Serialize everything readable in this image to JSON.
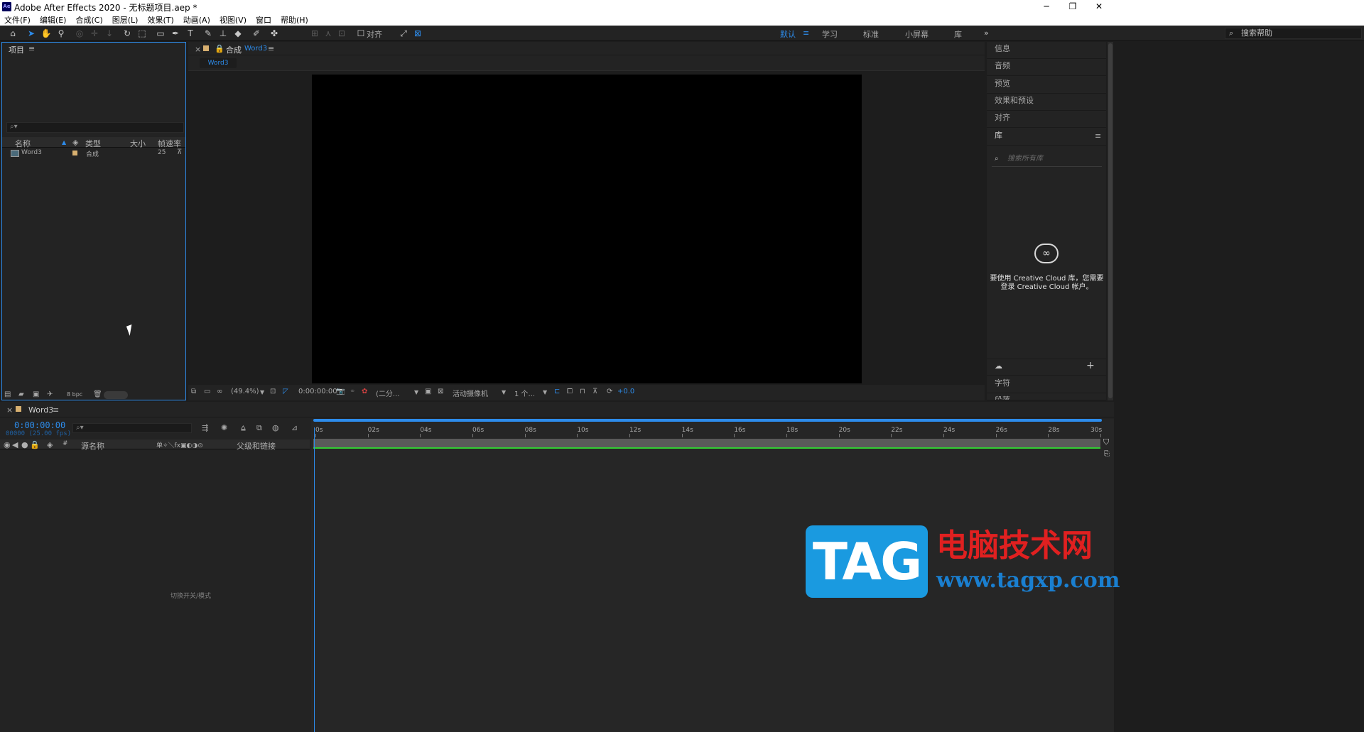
{
  "window": {
    "app_icon": "Ae",
    "title": "Adobe After Effects 2020 - 无标题项目.aep *",
    "minimize": "─",
    "maximize": "❐",
    "close": "✕"
  },
  "menu": [
    "文件(F)",
    "编辑(E)",
    "合成(C)",
    "图层(L)",
    "效果(T)",
    "动画(A)",
    "视图(V)",
    "窗口",
    "帮助(H)"
  ],
  "toolbar": {
    "align_label": "对齐",
    "workspaces": [
      "默认",
      "学习",
      "标准",
      "小屏幕",
      "库"
    ],
    "active_workspace": "默认",
    "more": "»",
    "help_search_placeholder": "搜索帮助"
  },
  "project": {
    "title": "项目",
    "search_placeholder": "⌕▾",
    "columns": [
      "名称",
      "类型",
      "大小",
      "帧速率"
    ],
    "items": [
      {
        "name": "Word3",
        "type": "合成",
        "size": "",
        "fps": "25"
      }
    ],
    "bpc": "8 bpc"
  },
  "composition": {
    "title_prefix": "合成",
    "comp_name": "Word3",
    "subtab": "Word3",
    "zoom": "(49.4%)",
    "timecode": "0:00:00:00",
    "resolution": "(二分...",
    "camera": "活动摄像机",
    "views": "1 个...",
    "exposure": "+0.0"
  },
  "right_panels": {
    "items": [
      "信息",
      "音频",
      "预览",
      "效果和预设",
      "对齐"
    ],
    "library_title": "库",
    "library_search_placeholder": "搜索所有库",
    "library_message": "要使用 Creative Cloud 库，您需要登录 Creative Cloud 帐户。",
    "character": "字符",
    "paragraph": "段落"
  },
  "timeline": {
    "comp_name": "Word3",
    "time": "0:00:00:00",
    "fps_info": "00000 (25.00 fps)",
    "search_placeholder": "⌕▾",
    "col_source": "源名称",
    "col_parent": "父级和链接",
    "col_hash": "#",
    "ticks": [
      "0s",
      "02s",
      "04s",
      "06s",
      "08s",
      "10s",
      "12s",
      "14s",
      "16s",
      "18s",
      "20s",
      "22s",
      "24s",
      "26s",
      "28s",
      "30s"
    ],
    "footer": "切换开关/模式"
  },
  "watermark": {
    "tag": "TAG",
    "cn": "电脑技术网",
    "url": "www.tagxp.com"
  }
}
